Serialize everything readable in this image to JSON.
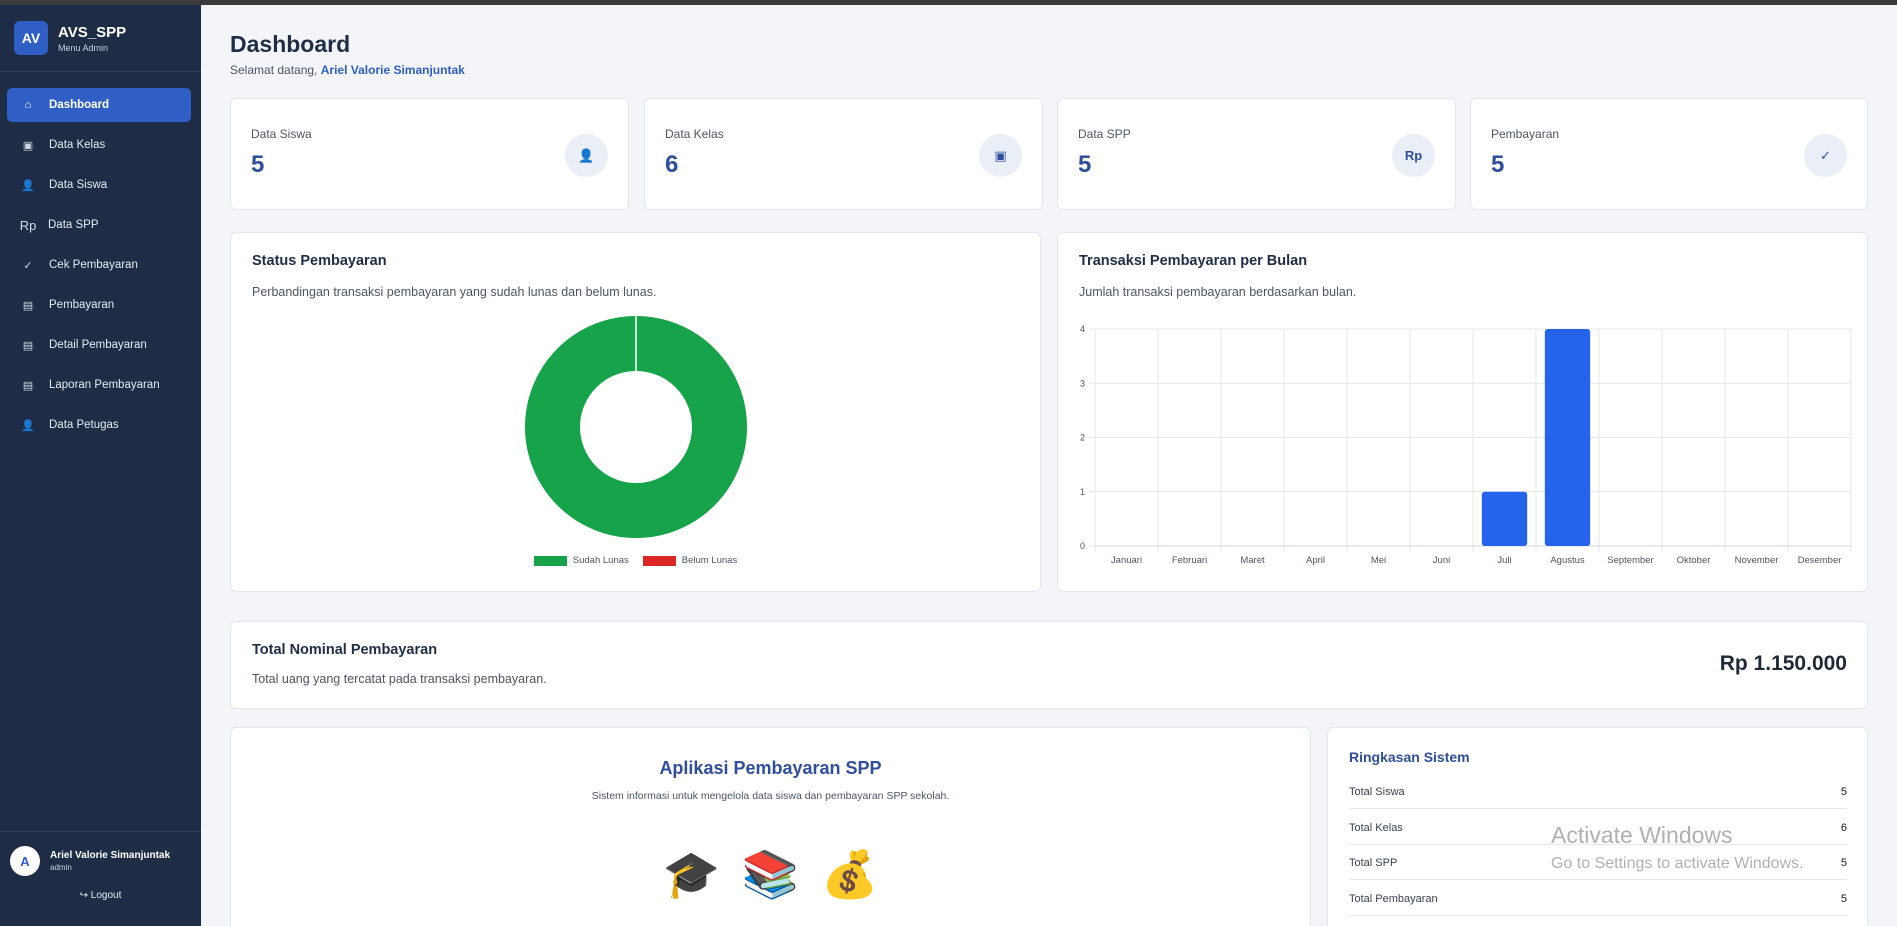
{
  "brand": {
    "logo_text": "AV",
    "title": "AVS_SPP",
    "subtitle": "Menu Admin"
  },
  "sidebar": {
    "items": [
      {
        "label": "Dashboard",
        "icon": "home-icon",
        "glyph": "⌂",
        "active": true
      },
      {
        "label": "Data Kelas",
        "icon": "class-icon",
        "glyph": "▣",
        "active": false
      },
      {
        "label": "Data Siswa",
        "icon": "person-icon",
        "glyph": "👤",
        "active": false
      },
      {
        "label": "Data SPP",
        "icon": "rupiah-icon",
        "glyph": "Rp",
        "active": false
      },
      {
        "label": "Cek Pembayaran",
        "icon": "check-icon",
        "glyph": "✓",
        "active": false
      },
      {
        "label": "Pembayaran",
        "icon": "list-icon",
        "glyph": "▤",
        "active": false
      },
      {
        "label": "Detail Pembayaran",
        "icon": "list-icon",
        "glyph": "▤",
        "active": false
      },
      {
        "label": "Laporan Pembayaran",
        "icon": "list-icon",
        "glyph": "▤",
        "active": false
      },
      {
        "label": "Data Petugas",
        "icon": "person-icon",
        "glyph": "👤",
        "active": false
      }
    ]
  },
  "user": {
    "avatar": "A",
    "name": "Ariel Valorie Simanjuntak",
    "role": "admin",
    "logout_label": "↪ Logout"
  },
  "header": {
    "title": "Dashboard",
    "welcome_prefix": "Selamat datang,",
    "welcome_name": "Ariel Valorie Simanjuntak"
  },
  "stats": [
    {
      "label": "Data Siswa",
      "value": "5",
      "icon": "person-icon",
      "glyph": "👤"
    },
    {
      "label": "Data Kelas",
      "value": "6",
      "icon": "class-icon",
      "glyph": "▣"
    },
    {
      "label": "Data SPP",
      "value": "5",
      "icon": "rupiah-icon",
      "glyph": "Rp"
    },
    {
      "label": "Pembayaran",
      "value": "5",
      "icon": "check-icon",
      "glyph": "✓"
    }
  ],
  "status_card": {
    "title": "Status Pembayaran",
    "description": "Perbandingan transaksi pembayaran yang sudah lunas dan belum lunas."
  },
  "monthly_card": {
    "title": "Transaksi Pembayaran per Bulan",
    "description": "Jumlah transaksi pembayaran berdasarkan bulan."
  },
  "chart_data": [
    {
      "type": "pie",
      "variant": "doughnut",
      "categories": [
        "Sudah Lunas",
        "Belum Lunas"
      ],
      "values": [
        5,
        0
      ],
      "colors": [
        "#16a34a",
        "#dc2626"
      ],
      "legend": "bottom"
    },
    {
      "type": "bar",
      "categories": [
        "Januari",
        "Februari",
        "Maret",
        "April",
        "Mei",
        "Juni",
        "Juli",
        "Agustus",
        "September",
        "Oktober",
        "November",
        "Desember"
      ],
      "values": [
        0,
        0,
        0,
        0,
        0,
        0,
        1,
        4,
        0,
        0,
        0,
        0
      ],
      "ylim": [
        0,
        4
      ],
      "yticks": [
        "0",
        "1",
        "2",
        "3",
        "4"
      ],
      "color": "#2563eb",
      "grid": true
    }
  ],
  "total_card": {
    "title": "Total Nominal Pembayaran",
    "description": "Total uang yang tercatat pada transaksi pembayaran.",
    "amount": "Rp 1.150.000"
  },
  "app_card": {
    "title": "Aplikasi Pembayaran SPP",
    "description": "Sistem informasi untuk mengelola data siswa dan pembayaran SPP sekolah.",
    "emojis": [
      {
        "icon": "graduation-cap-icon",
        "glyph": "🎓"
      },
      {
        "icon": "books-icon",
        "glyph": "📚"
      },
      {
        "icon": "money-bag-icon",
        "glyph": "💰"
      }
    ]
  },
  "summary": {
    "title": "Ringkasan Sistem",
    "rows": [
      {
        "label": "Total Siswa",
        "value": "5"
      },
      {
        "label": "Total Kelas",
        "value": "6"
      },
      {
        "label": "Total SPP",
        "value": "5"
      },
      {
        "label": "Total Pembayaran",
        "value": "5"
      }
    ]
  },
  "watermark": {
    "line1": "Activate Windows",
    "line2": "Go to Settings to activate Windows."
  }
}
